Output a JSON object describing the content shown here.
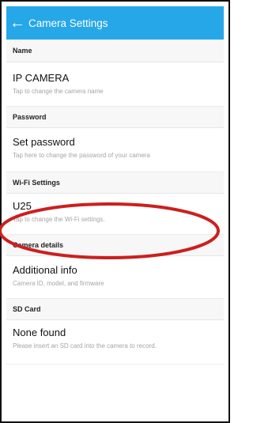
{
  "app_bar": {
    "back_icon": "arrow-left-icon",
    "title": "Camera Settings",
    "color": "#26a7e8"
  },
  "sections": [
    {
      "header": "Name",
      "title": "IP CAMERA",
      "subtitle": "Tap to change the camera name"
    },
    {
      "header": "Password",
      "title": "Set password",
      "subtitle": "Tap here to change the password of your camera"
    },
    {
      "header": "Wi-Fi Settings",
      "title": "U25",
      "subtitle": "Tap to change the Wi-Fi settings."
    },
    {
      "header": "Camera details",
      "title": "Additional info",
      "subtitle": "Camera ID, model, and firmware"
    },
    {
      "header": "SD Card",
      "title": "None found",
      "subtitle": "Please insert an SD card into the camera to record."
    }
  ],
  "annotation": {
    "shape": "ellipse",
    "color": "#cc1f1f"
  }
}
